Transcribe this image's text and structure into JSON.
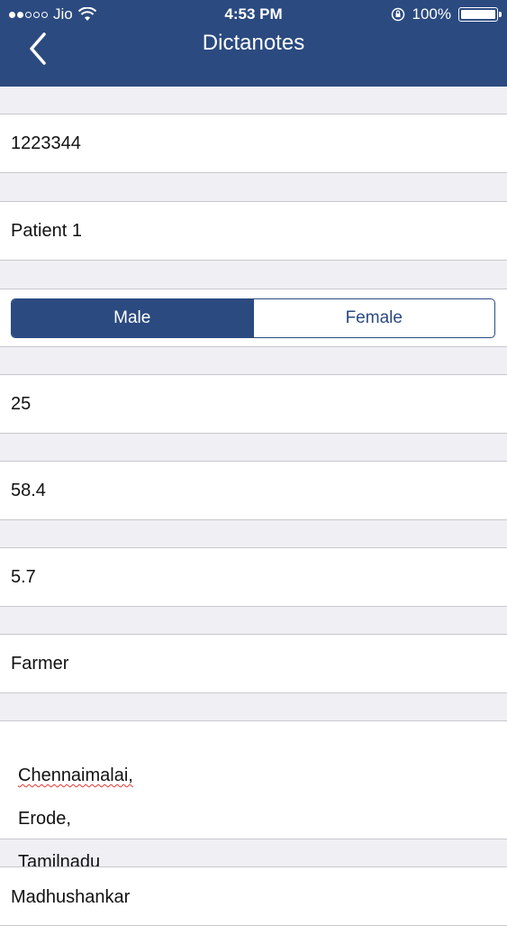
{
  "status_bar": {
    "carrier": "Jio",
    "time": "4:53 PM",
    "battery": "100%"
  },
  "nav": {
    "title": "Dictanotes"
  },
  "form": {
    "patient_id": "1223344",
    "patient_name": "Patient 1",
    "gender": {
      "options": [
        "Male",
        "Female"
      ],
      "selected": "Male"
    },
    "age": "25",
    "weight": "58.4",
    "height": "5.7",
    "occupation": "Farmer",
    "address": {
      "line1": "Chennaimalai,",
      "line2": "Erode,",
      "line3": "Tamilnadu"
    },
    "referred_by": "Madhushankar"
  },
  "colors": {
    "nav_bar": "#2b4a80",
    "background": "#efeff4",
    "spellcheck_underline": "#e53935"
  }
}
